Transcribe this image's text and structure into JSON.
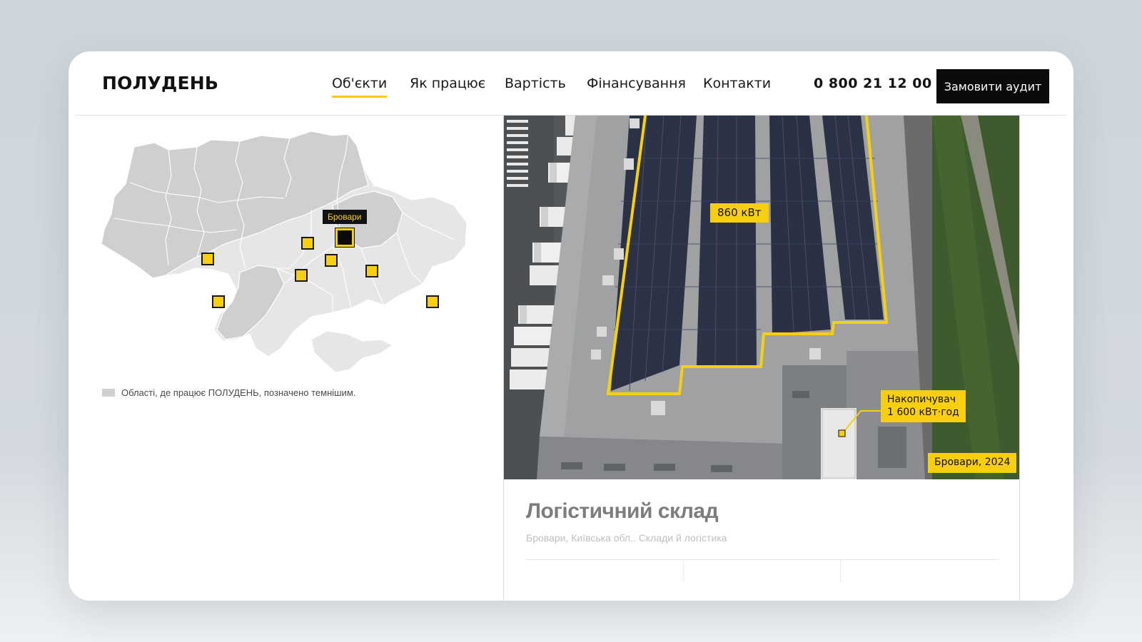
{
  "brand": {
    "logo": "ПОЛУДЕНЬ"
  },
  "nav": {
    "items": [
      {
        "label": "Об'єкти",
        "active": true
      },
      {
        "label": "Як працює",
        "active": false
      },
      {
        "label": "Вартість",
        "active": false
      },
      {
        "label": "Фінансування",
        "active": false
      },
      {
        "label": "Контакти",
        "active": false
      }
    ],
    "phone": "0 800 21 12 00",
    "cta_label": "Замовити аудит"
  },
  "map": {
    "tooltip": "Бровари",
    "legend": "Області, де працює ПОЛУДЕНЬ, позначено темнішим.",
    "colors": {
      "active_region": "#cfcfcf",
      "inactive_region": "#e6e6e6",
      "marker": "#f8cf0f",
      "selected_marker": "#0b0b0b"
    }
  },
  "project": {
    "power_tag": "860 кВт",
    "storage_tag_line1": "Накопичувач",
    "storage_tag_line2": "1 600 кВт·год",
    "location_tag": "Бровари, 2024",
    "title": "Логістичний склад",
    "subtitle": "Бровари, Київська обл.. Склади й логістика"
  },
  "accent_color": "#f8cf0f"
}
